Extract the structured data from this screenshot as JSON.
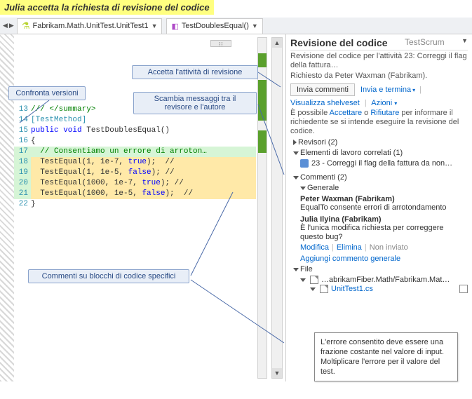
{
  "banner": "Julia accetta la richiesta di revisione del codice",
  "tabs": {
    "file": "Fabrikam.Math.UnitTest.UnitTest1",
    "member": "TestDoublesEqual()"
  },
  "callouts": {
    "compare": "Confronta versioni",
    "accept": "Accetta l'attività di revisione",
    "exchange": "Scambia messaggi tra il\nrevisore e l'autore",
    "codecomments": "Commenti su blocchi di codice specifici"
  },
  "code": {
    "lines": [
      {
        "n": "13",
        "txt": "/// </summary>",
        "cls": "cm"
      },
      {
        "n": "14",
        "txt": "[TestMethod]",
        "cls": "ty"
      },
      {
        "n": "15",
        "pre": "public void ",
        "name": "TestDoublesEqual",
        "post": "()"
      },
      {
        "n": "16",
        "txt": "{"
      },
      {
        "n": "17",
        "txt": "  // Consentiamo un errore di arroton…",
        "cls": "cm",
        "diff": true
      },
      {
        "n": "18",
        "call": "  TestEqual(1, 1e-7, ",
        "val": "true",
        "end": ");  //",
        "diff": true,
        "hl": true
      },
      {
        "n": "19",
        "call": "  TestEqual(1, 1e-5, ",
        "val": "false",
        "end": "); //",
        "diff": true,
        "hl": true
      },
      {
        "n": "20",
        "call": "  TestEqual(1000, 1e-7, ",
        "val": "true",
        "end": "); //",
        "diff": true,
        "hl": true
      },
      {
        "n": "21",
        "call": "  TestEqual(1000, 1e-5, ",
        "val": "false",
        "end": ");  //",
        "diff": true,
        "hl": true
      },
      {
        "n": "22",
        "txt": "}"
      }
    ]
  },
  "panel": {
    "title": "Revisione del codice",
    "team": "TestScrum",
    "desc1": "Revisione del codice per l'attività 23: Correggi il flag della fattura…",
    "desc2": "Richiesto da Peter Waxman (Fabrikam).",
    "send": "Invia commenti",
    "sendFinish": "Invia e termina",
    "viewShelve": "Visualizza shelveset",
    "actions": "Azioni",
    "helpPre": "È possibile ",
    "accept": "Accettare",
    "or": " o ",
    "decline": "Rifiutare",
    "helpPost": " per informare il richiedente se si intende eseguire la revisione del codice.",
    "reviewers": "Revisori (2)",
    "related": "Elementi di lavoro correlati (1)",
    "workitem": "23 - Correggi il flag della fattura da non…",
    "comments": "Commenti (2)",
    "general": "Generale",
    "c1a": "Peter Waxman (Fabrikam)",
    "c1b": "EqualTo consente errori di arrotondamento",
    "c2a": "Julia Ilyina (Fabrikam)",
    "c2b": "È l'unica modifica richiesta per correggere questo bug?",
    "edit": "Modifica",
    "del": "Elimina",
    "unsent": "Non inviato",
    "addGeneral": "Aggiungi commento generale",
    "file": "File",
    "filePath": "…abrikamFiber.Math/Fabrikam.Mat…",
    "fileName": "UnitTest1.cs",
    "popup": "L'errore consentito deve essere una frazione costante nel valore di input. Moltiplicare l'errore per il valore del test."
  }
}
